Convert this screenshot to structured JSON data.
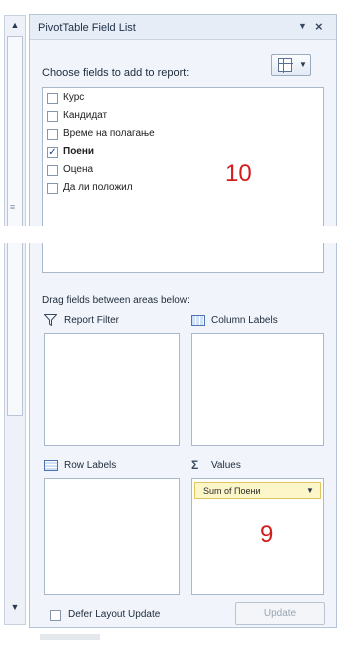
{
  "window": {
    "title": "PivotTable Field List",
    "menu_icon": "dropdown-arrow",
    "close_icon": "close-x"
  },
  "fields_section": {
    "label": "Choose fields to add to report:",
    "layout_button_icon": "field-list-layout-icon",
    "fields": [
      {
        "label": "Курс",
        "checked": false
      },
      {
        "label": "Кандидат",
        "checked": false
      },
      {
        "label": "Време на полагање",
        "checked": false
      },
      {
        "label": "Поени",
        "checked": true
      },
      {
        "label": "Оцена",
        "checked": false
      },
      {
        "label": "Да ли положил",
        "checked": false
      }
    ],
    "annotation": "10"
  },
  "areas": {
    "drag_label": "Drag fields between areas below:",
    "report_filter": {
      "label": "Report Filter",
      "icon": "filter-funnel-icon"
    },
    "column_labels": {
      "label": "Column Labels",
      "icon": "column-grid-icon"
    },
    "row_labels": {
      "label": "Row Labels",
      "icon": "row-grid-icon"
    },
    "values": {
      "label": "Values",
      "icon": "sigma-icon",
      "sigma": "Σ",
      "items": [
        {
          "label": "Sum of Поени"
        }
      ],
      "annotation": "9"
    }
  },
  "footer": {
    "defer_label": "Defer Layout Update",
    "defer_checked": false,
    "update_label": "Update"
  },
  "colors": {
    "annotation_red": "#d41c1c",
    "pane_bg": "#f1f5fb",
    "chip_bg": "#fdf6c8"
  }
}
